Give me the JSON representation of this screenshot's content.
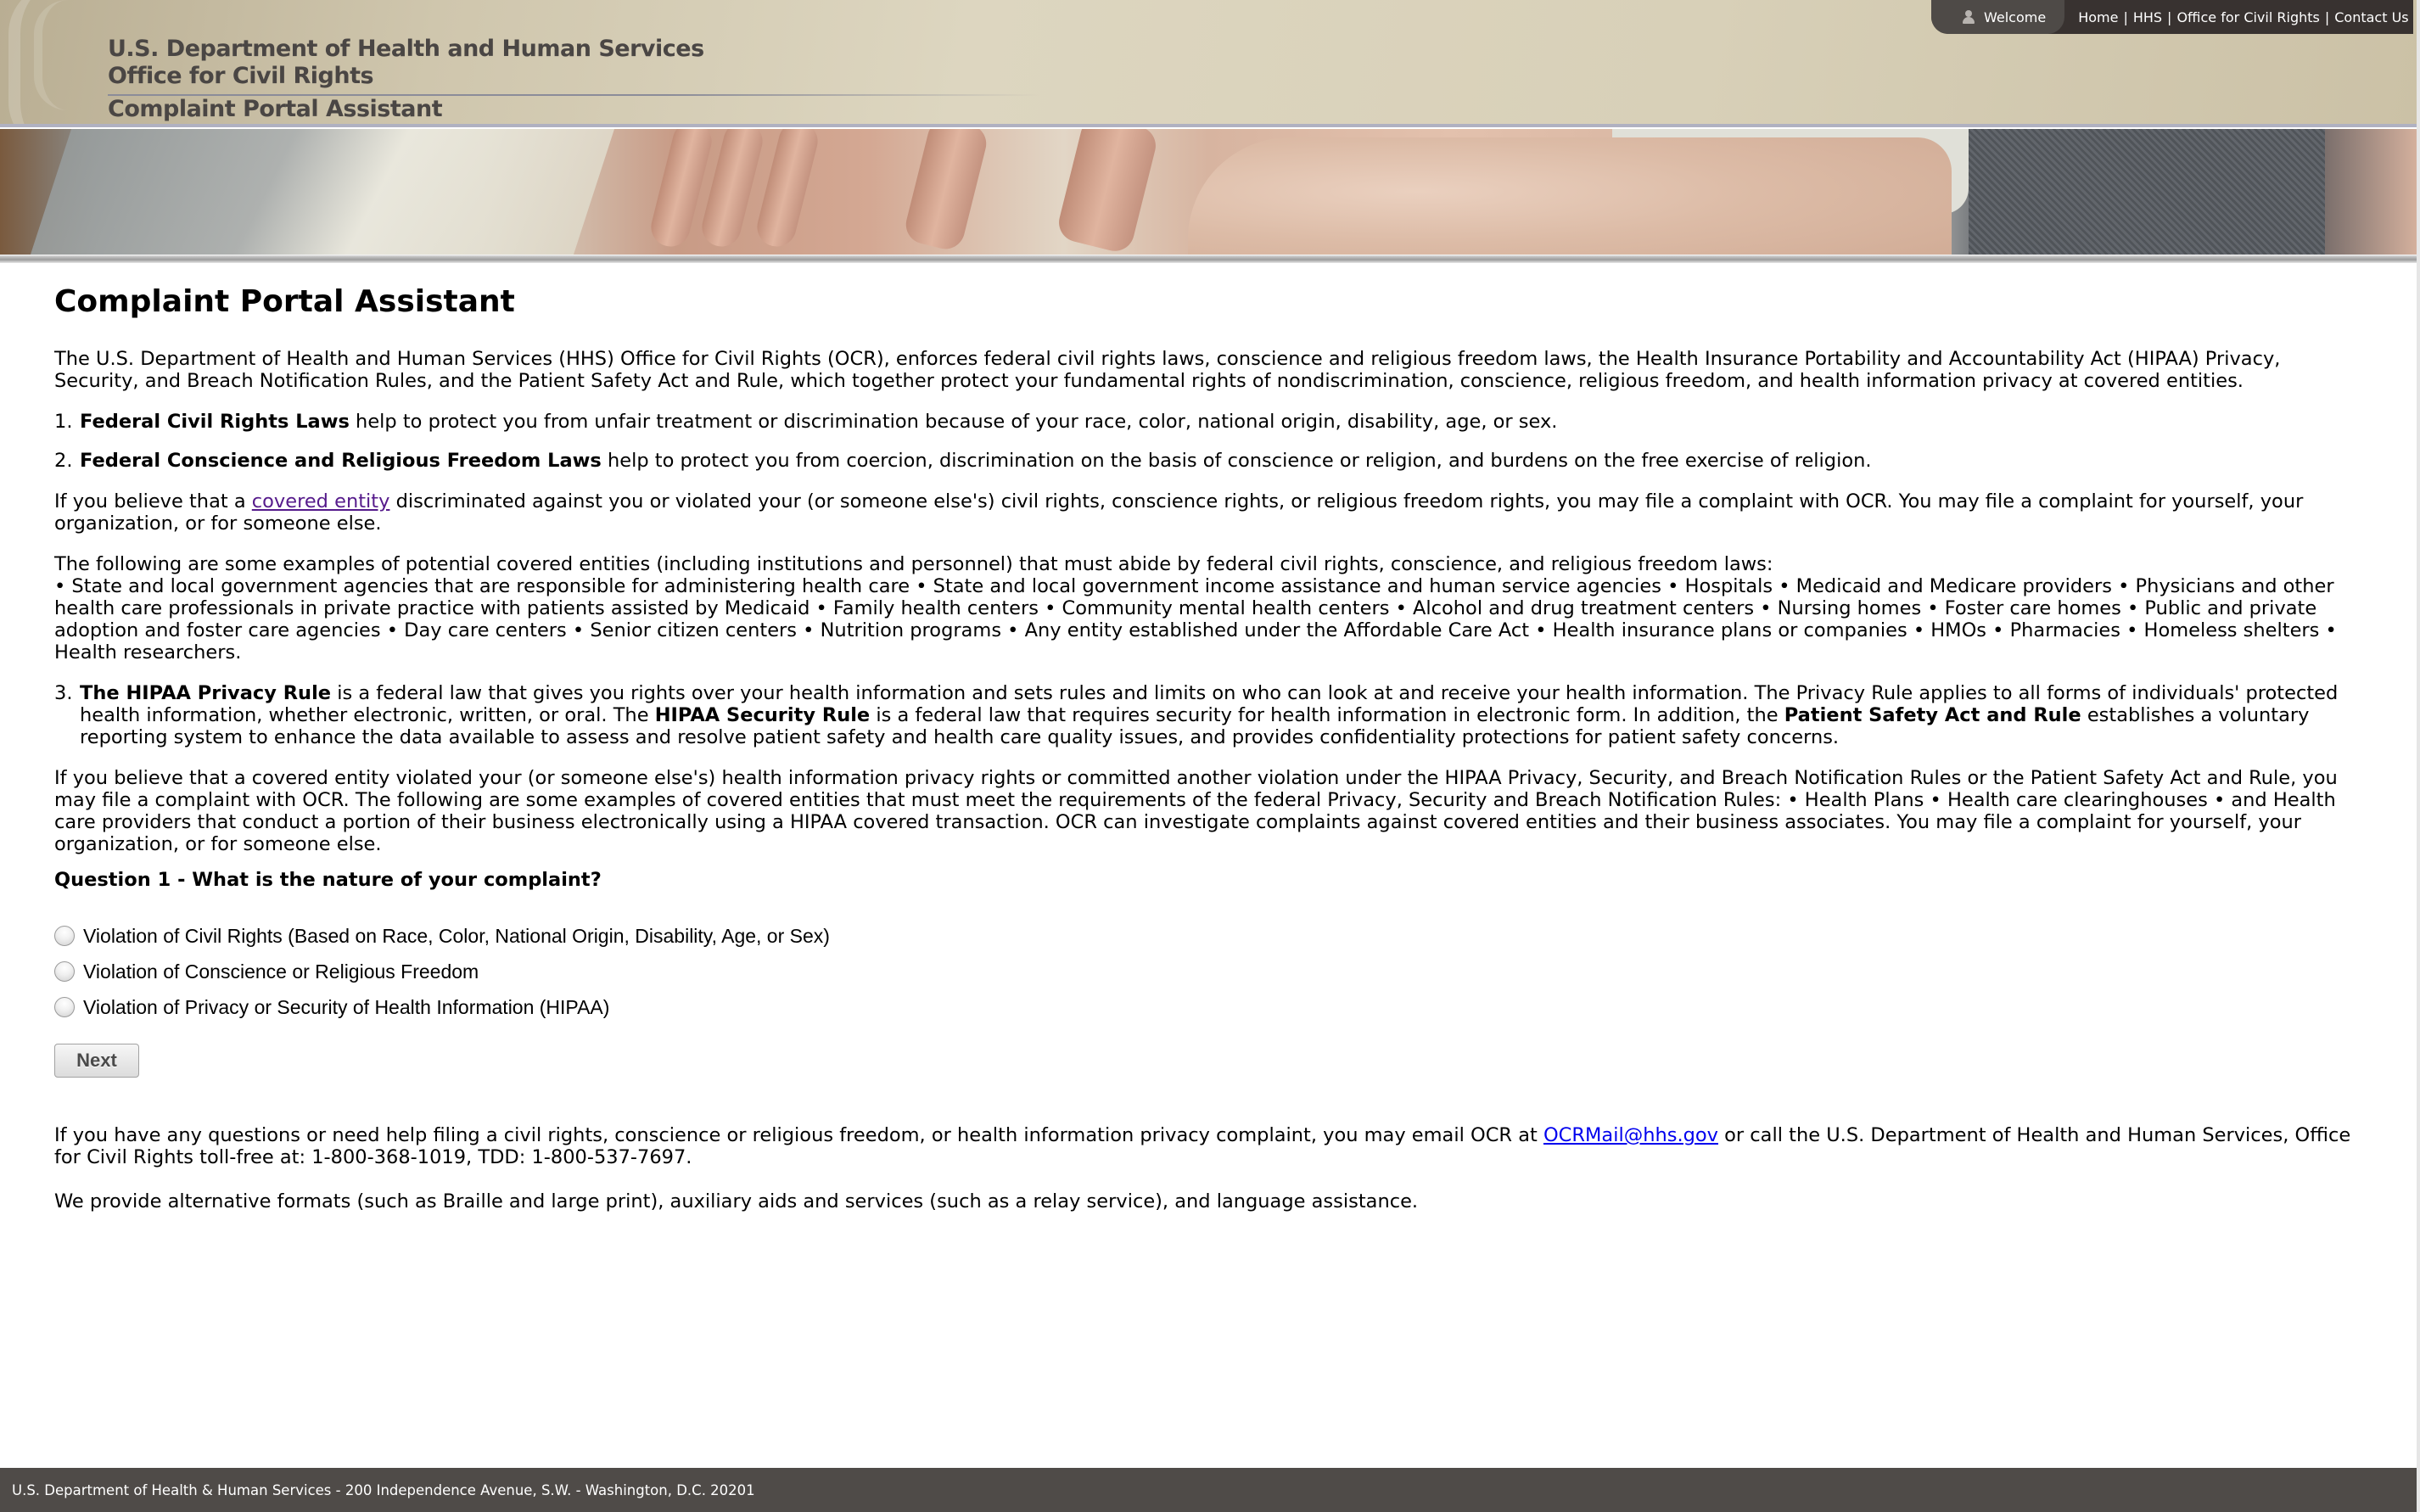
{
  "header": {
    "line1": "U.S. Department of Health and Human Services",
    "line2": "Office for Civil Rights",
    "line3": "Complaint Portal Assistant"
  },
  "topnav": {
    "welcome": "Welcome",
    "links": [
      "Home",
      "HHS",
      "Office for Civil Rights",
      "Contact Us"
    ],
    "separator": "|"
  },
  "main": {
    "title": "Complaint Portal Assistant",
    "intro": "The U.S. Department of Health and Human Services (HHS) Office for Civil Rights (OCR), enforces federal civil rights laws, conscience and religious freedom laws, the Health Insurance Portability and Accountability Act (HIPAA) Privacy, Security, and Breach Notification Rules, and the Patient Safety Act and Rule, which together protect your fundamental rights of nondiscrimination, conscience, religious freedom, and health information privacy at covered entities.",
    "item1": {
      "num": "1.",
      "bold": "Federal Civil Rights Laws",
      "text": " help to protect you from unfair treatment or discrimination because of your race, color, national origin, disability, age, or sex."
    },
    "item2": {
      "num": "2.",
      "bold": "Federal Conscience and Religious Freedom Laws",
      "text": " help to protect you from coercion, discrimination on the basis of conscience or religion, and burdens on the free exercise of religion.",
      "para1_pre": "If you believe that a ",
      "para1_link": "covered entity",
      "para1_post": " discriminated against you or violated your (or someone else's) civil rights, conscience rights, or religious freedom rights, you may file a complaint with OCR. You may file a complaint for yourself, your organization, or for someone else.",
      "para2": "The following are some examples of potential covered entities (including institutions and personnel) that must abide by federal civil rights, conscience, and religious freedom laws:",
      "bullets": "• State and local government agencies that are responsible for administering health care • State and local government income assistance and human service agencies • Hospitals • Medicaid and Medicare providers • Physicians and other health care professionals in private practice with patients assisted by Medicaid • Family health centers • Community mental health centers • Alcohol and drug treatment centers • Nursing homes • Foster care homes • Public and private adoption and foster care agencies • Day care centers • Senior citizen centers • Nutrition programs • Any entity established under the Affordable Care Act • Health insurance plans or companies • HMOs • Pharmacies • Homeless shelters • Health researchers."
    },
    "item3": {
      "num": "3.",
      "bold1": "The HIPAA Privacy Rule",
      "text1": " is a federal law that gives you rights over your health information and sets rules and limits on who can look at and receive your health information. The Privacy Rule applies to all forms of individuals' protected health information, whether electronic, written, or oral. The ",
      "bold2": "HIPAA Security Rule",
      "text2": " is a federal law that requires security for health information in electronic form. In addition, the ",
      "bold3": "Patient Safety Act and Rule",
      "text3": " establishes a voluntary reporting system to enhance the data available to assess and resolve patient safety and health care quality issues, and provides confidentiality protections for patient safety concerns.",
      "para": "If you believe that a covered entity violated your (or someone else's) health information privacy rights or committed another violation under the HIPAA Privacy, Security, and Breach Notification Rules or the Patient Safety Act and Rule, you may file a complaint with OCR. The following are some examples of covered entities that must meet the requirements of the federal Privacy, Security and Breach Notification Rules: • Health Plans • Health care clearinghouses • and Health care providers that conduct a portion of their business electronically using a HIPAA covered transaction. OCR can investigate complaints against covered entities and their business associates. You may file a complaint for yourself, your organization, or for someone else."
    }
  },
  "question": {
    "label": "Question 1 - What is the nature of your complaint?",
    "options": [
      {
        "label": "Violation of Civil Rights (Based on Race, Color, National Origin, Disability, Age, or Sex)",
        "selected": false
      },
      {
        "label": "Violation of Conscience or Religious Freedom",
        "selected": false
      },
      {
        "label": "Violation of Privacy or Security of Health Information (HIPAA)",
        "selected": false
      }
    ],
    "next_label": "Next"
  },
  "help": {
    "p1_pre": "If you have any questions or need help filing a civil rights, conscience or religious freedom, or health information privacy complaint, you may email OCR at ",
    "email": "OCRMail@hhs.gov",
    "p1_post": " or call the U.S. Department of Health and Human Services, Office for Civil Rights toll-free at: 1-800-368-1019, TDD: 1-800-537-7697.",
    "p2": "We provide alternative formats (such as Braille and large print), auxiliary aids and services (such as a relay service), and language assistance."
  },
  "footer": {
    "text": "U.S. Department of Health & Human Services - 200 Independence Avenue, S.W. - Washington, D.C. 20201"
  },
  "colors": {
    "header_bg": "#d8d0b8",
    "header_text": "#4a4644",
    "topnav_bg": "#383230",
    "footer_bg": "#4f4b48",
    "visited_link": "#551a8b",
    "link": "#0000ee"
  }
}
